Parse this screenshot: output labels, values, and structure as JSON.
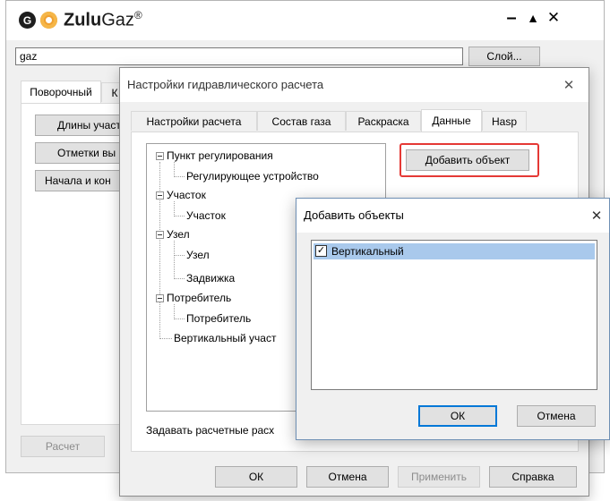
{
  "main_window": {
    "title_brand": "Zulu",
    "title_brand2": "Gaz",
    "title_reg": "®",
    "logo_letter": "G",
    "layer_name": "gaz",
    "layer_button": "Слой...",
    "tabs": [
      "Поворочный",
      "К"
    ],
    "buttons": [
      "Длины участ",
      "Отметки вы",
      "Начала и кон"
    ],
    "calc_button": "Расчет",
    "controls": {
      "minimize": "–",
      "maximize": "▲",
      "close": "✕"
    }
  },
  "settings_dialog": {
    "title": "Настройки гидравлического расчета",
    "close": "✕",
    "tabs": [
      "Настройки расчета",
      "Состав газа",
      "Раскраска",
      "Данные",
      "Hasp"
    ],
    "active_tab": "Данные",
    "tree": [
      "Пункт регулирования",
      "Регулирующее устройство",
      "Участок",
      "Участок",
      "Узел",
      "Узел",
      "Задвижка",
      "Потребитель",
      "Потребитель",
      "Вертикальный участ"
    ],
    "add_object_button": "Добавить объект",
    "bottom_label": "Задавать расчетные расх",
    "footer_buttons": {
      "ok": "ОК",
      "cancel": "Отмена",
      "apply": "Применить",
      "help": "Справка"
    }
  },
  "add_dialog": {
    "title": "Добавить объекты",
    "close": "✕",
    "items": [
      {
        "label": "Вертикальный",
        "checked": true
      }
    ],
    "ok": "ОК",
    "cancel": "Отмена"
  },
  "colors": {
    "highlight": "#a9c9ec",
    "focus_red": "#e53935",
    "accent_blue": "#0078d7",
    "brand_orange": "#f0a030"
  }
}
